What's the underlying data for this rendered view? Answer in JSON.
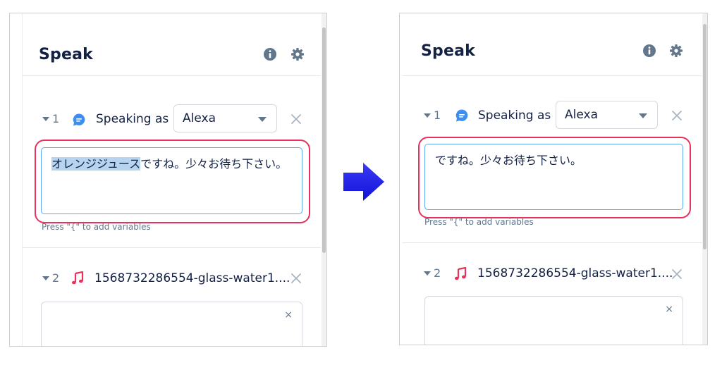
{
  "left": {
    "title": "Speak",
    "step1": {
      "number": "1",
      "speaking_as_label": "Speaking as",
      "voice_value": "Alexa",
      "text_highlighted": "オレンジジュース",
      "text_rest": "ですね。少々お待ち下さい。",
      "hint": "Press \"{\" to add variables"
    },
    "step2": {
      "number": "2",
      "file_name": "1568732286554-glass-water1....",
      "close_glyph": "×"
    }
  },
  "right": {
    "title": "Speak",
    "step1": {
      "number": "1",
      "speaking_as_label": "Speaking as",
      "voice_value": "Alexa",
      "text": "ですね。少々お待ち下さい。",
      "hint": "Press \"{\" to add variables"
    },
    "step2": {
      "number": "2",
      "file_name": "1568732286554-glass-water1....",
      "close_glyph": "×"
    }
  },
  "colors": {
    "accent_blue": "#5da9f0",
    "speak_icon_blue": "#3c8ef3",
    "music_icon_red": "#e8315b",
    "annotation_red": "#e8315b",
    "arrow_blue": "#1a1ae6",
    "text_dark": "#132144",
    "muted": "#62778c"
  },
  "icons": {
    "info": "info-icon",
    "settings": "gear-icon",
    "speak": "speech-bubble-icon",
    "music": "music-note-icon",
    "close": "close-icon",
    "arrow": "right-arrow-icon"
  }
}
